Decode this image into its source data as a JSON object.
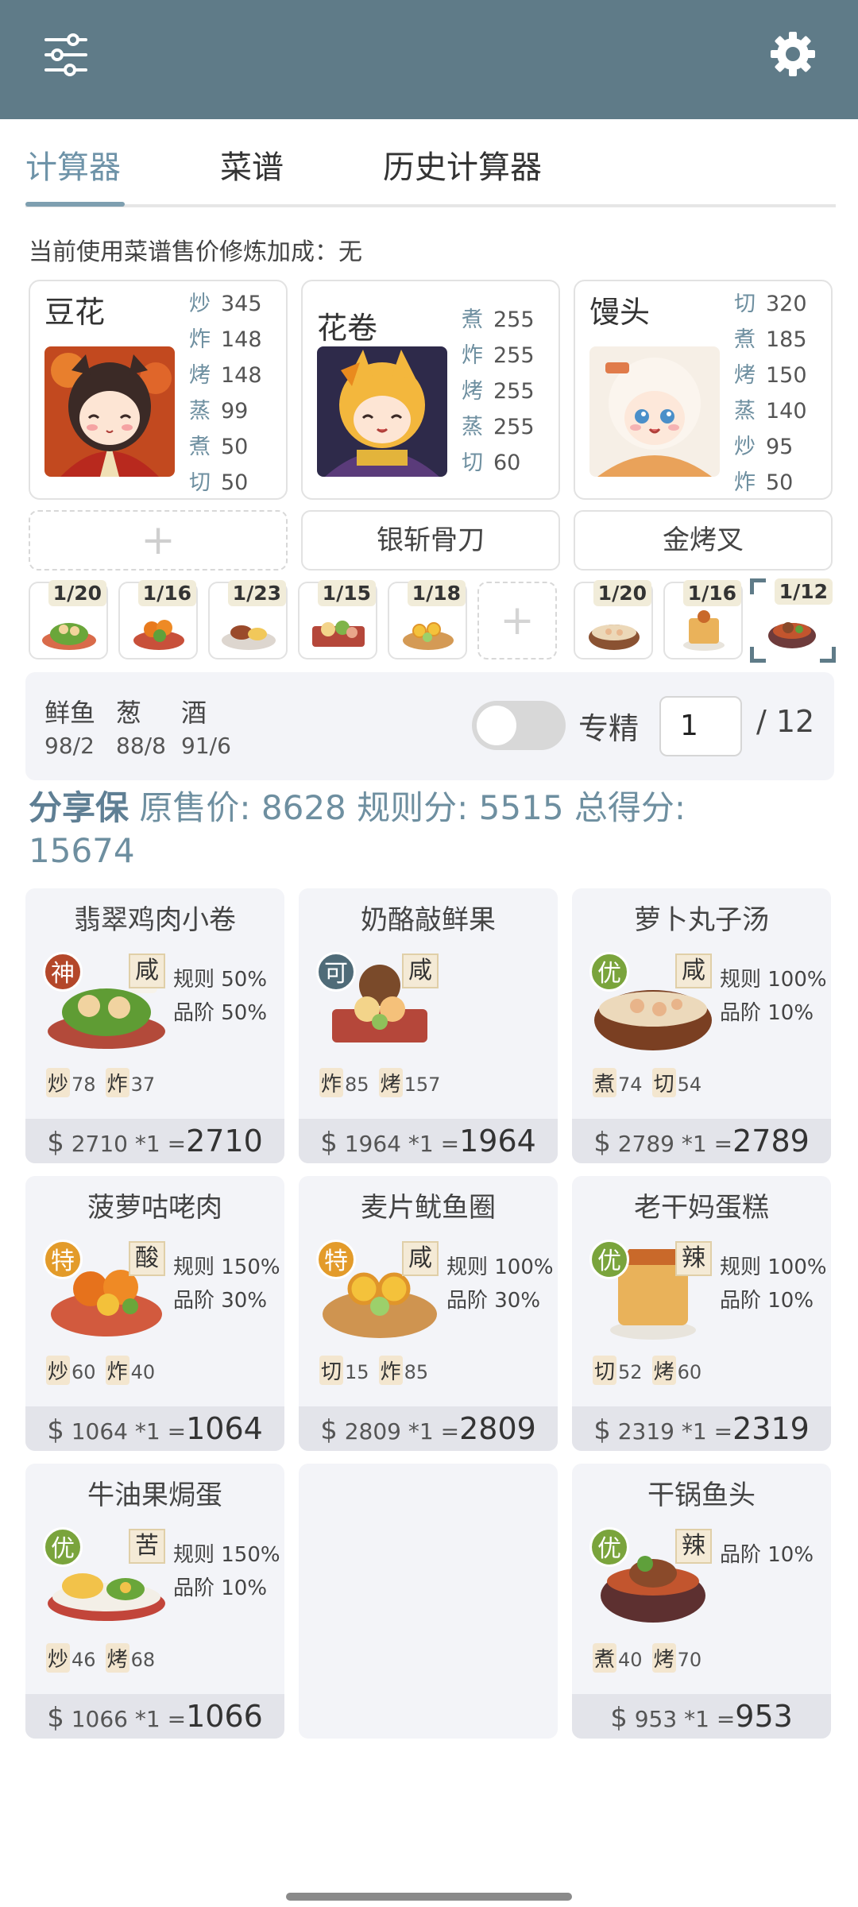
{
  "header": {
    "menu_icon": "sliders-icon",
    "settings_icon": "gear-icon",
    "bg_color": "#5f7b88"
  },
  "tabs": [
    {
      "label": "计算器",
      "active": true
    },
    {
      "label": "菜谱",
      "active": false
    },
    {
      "label": "历史计算器",
      "active": false
    }
  ],
  "bonus_text": "当前使用菜谱售价修炼加成：无",
  "chefs": [
    {
      "name": "豆花",
      "stats": [
        [
          "炒",
          "345"
        ],
        [
          "炸",
          "148"
        ],
        [
          "烤",
          "148"
        ],
        [
          "蒸",
          "99"
        ],
        [
          "煮",
          "50"
        ],
        [
          "切",
          "50"
        ]
      ]
    },
    {
      "name": "花卷",
      "stats": [
        [
          "煮",
          "255"
        ],
        [
          "炸",
          "255"
        ],
        [
          "烤",
          "255"
        ],
        [
          "蒸",
          "255"
        ],
        [
          "切",
          "60"
        ]
      ]
    },
    {
      "name": "馒头",
      "stats": [
        [
          "切",
          "320"
        ],
        [
          "煮",
          "185"
        ],
        [
          "烤",
          "150"
        ],
        [
          "蒸",
          "140"
        ],
        [
          "炒",
          "95"
        ],
        [
          "炸",
          "50"
        ]
      ]
    }
  ],
  "equipment": {
    "slot1_icon": "plus-icon",
    "slot2": "银斩骨刀",
    "slot3": "金烤叉"
  },
  "dish_slots": [
    "1/20",
    "1/16",
    "1/23",
    "1/15",
    "1/18",
    "",
    "1/20",
    "1/16",
    "1/12"
  ],
  "ingredients": [
    {
      "name": "鲜鱼",
      "value": "98/2"
    },
    {
      "name": "葱",
      "value": "88/8"
    },
    {
      "name": "酒",
      "value": "91/6"
    }
  ],
  "specialize": {
    "label": "专精",
    "on": false,
    "value": "1",
    "max": "/ 12"
  },
  "summary": {
    "strategy": "分享保",
    "orig_label": "原售价:",
    "orig_value": "8628",
    "rule_label": "规则分:",
    "rule_value": "5515",
    "total_label": "总得分:",
    "total_value": "15674"
  },
  "dishes": [
    {
      "title": "翡翠鸡肉小卷",
      "tier": "神",
      "tier_color": "#b4472a",
      "taste": "咸",
      "rule": "规则 50%",
      "grade": "品阶 50%",
      "skills": [
        [
          "炒",
          "78"
        ],
        [
          "炸",
          "37"
        ]
      ],
      "price": "2710 *1",
      "total": "2710"
    },
    {
      "title": "奶酪敲鲜果",
      "tier": "可",
      "tier_color": "#4f6b78",
      "taste": "咸",
      "rule": "",
      "grade": "",
      "skills": [
        [
          "炸",
          "85"
        ],
        [
          "烤",
          "157"
        ]
      ],
      "price": "1964 *1",
      "total": "1964"
    },
    {
      "title": "萝卜丸子汤",
      "tier": "优",
      "tier_color": "#7aa43c",
      "taste": "咸",
      "rule": "规则 100%",
      "grade": "品阶 10%",
      "skills": [
        [
          "煮",
          "74"
        ],
        [
          "切",
          "54"
        ]
      ],
      "price": "2789 *1",
      "total": "2789"
    },
    {
      "title": "菠萝咕咾肉",
      "tier": "特",
      "tier_color": "#e39b2a",
      "taste": "酸",
      "rule": "规则 150%",
      "grade": "品阶 30%",
      "skills": [
        [
          "炒",
          "60"
        ],
        [
          "炸",
          "40"
        ]
      ],
      "price": "1064 *1",
      "total": "1064"
    },
    {
      "title": "麦片鱿鱼圈",
      "tier": "特",
      "tier_color": "#e39b2a",
      "taste": "咸",
      "rule": "规则 100%",
      "grade": "品阶 30%",
      "skills": [
        [
          "切",
          "15"
        ],
        [
          "炸",
          "85"
        ]
      ],
      "price": "2809 *1",
      "total": "2809"
    },
    {
      "title": "老干妈蛋糕",
      "tier": "优",
      "tier_color": "#7aa43c",
      "taste": "辣",
      "rule": "规则 100%",
      "grade": "品阶 10%",
      "skills": [
        [
          "切",
          "52"
        ],
        [
          "烤",
          "60"
        ]
      ],
      "price": "2319 *1",
      "total": "2319"
    },
    {
      "title": "牛油果焗蛋",
      "tier": "优",
      "tier_color": "#7aa43c",
      "taste": "苦",
      "rule": "规则 150%",
      "grade": "品阶 10%",
      "skills": [
        [
          "炒",
          "46"
        ],
        [
          "烤",
          "68"
        ]
      ],
      "price": "1066 *1",
      "total": "1066"
    },
    {
      "title": "干锅鱼头",
      "tier": "优",
      "tier_color": "#7aa43c",
      "taste": "辣",
      "rule": "",
      "grade": "品阶 10%",
      "skills": [
        [
          "煮",
          "40"
        ],
        [
          "烤",
          "70"
        ]
      ],
      "price": "953 *1",
      "total": "953"
    }
  ],
  "currency_symbol": "$",
  "equals": "="
}
